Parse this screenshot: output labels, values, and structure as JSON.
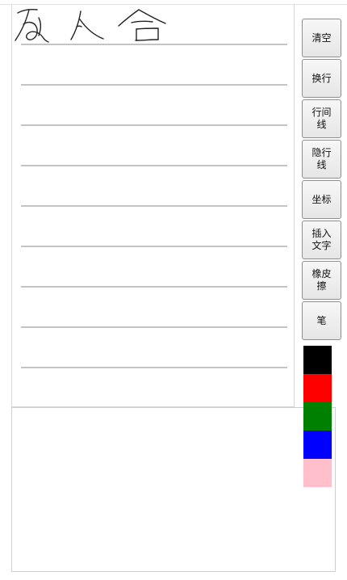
{
  "toolbar": {
    "buttons": [
      {
        "label": "清空"
      },
      {
        "label": "换行"
      },
      {
        "label": "行间\n线"
      },
      {
        "label": "隐行\n线"
      },
      {
        "label": "坐标"
      },
      {
        "label": "插入\n文字"
      },
      {
        "label": "橡皮\n擦"
      },
      {
        "label": "笔"
      }
    ]
  },
  "palette": {
    "colors": [
      "#000000",
      "#ff0000",
      "#008000",
      "#0000ff",
      "#ffc0cb"
    ]
  },
  "canvas": {
    "ruled_line_color": "#b0b0b0"
  },
  "text_area": {
    "value": ""
  }
}
